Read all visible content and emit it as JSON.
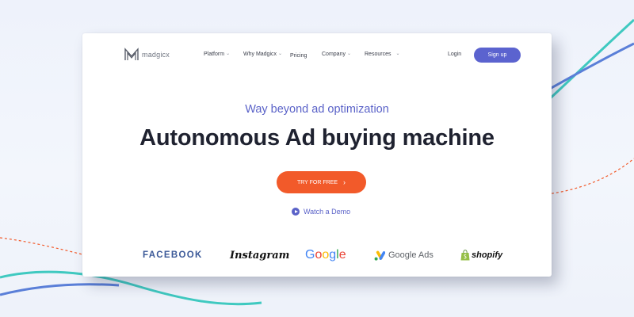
{
  "brand": {
    "name": "madgicx"
  },
  "nav": {
    "items": [
      {
        "label": "Platform",
        "dropdown": true
      },
      {
        "label": "Why Madgicx",
        "dropdown": true
      },
      {
        "label": "Pricing",
        "dropdown": false
      },
      {
        "label": "Company",
        "dropdown": true
      },
      {
        "label": "Resources",
        "dropdown": true
      }
    ],
    "login_label": "Login",
    "signup_label": "Sign up"
  },
  "hero": {
    "tagline": "Way beyond ad optimization",
    "headline": "Autonomous Ad buying machine",
    "cta_label": "TRY FOR FREE",
    "demo_label": "Watch a Demo"
  },
  "partners": {
    "facebook": "FACEBOOK",
    "instagram": "Instagram",
    "google_letters": [
      "G",
      "o",
      "o",
      "g",
      "l",
      "e"
    ],
    "google_ads": "Google Ads",
    "shopify": "shopify"
  },
  "colors": {
    "accent": "#5b63cf",
    "cta": "#f25a2a",
    "teal_wave": "#3fc9c0",
    "blue_wave": "#5a7fd8",
    "dashed_line": "#f25a2a",
    "google": [
      "#4285F4",
      "#EA4335",
      "#FBBC05",
      "#4285F4",
      "#34A853",
      "#EA4335"
    ]
  }
}
